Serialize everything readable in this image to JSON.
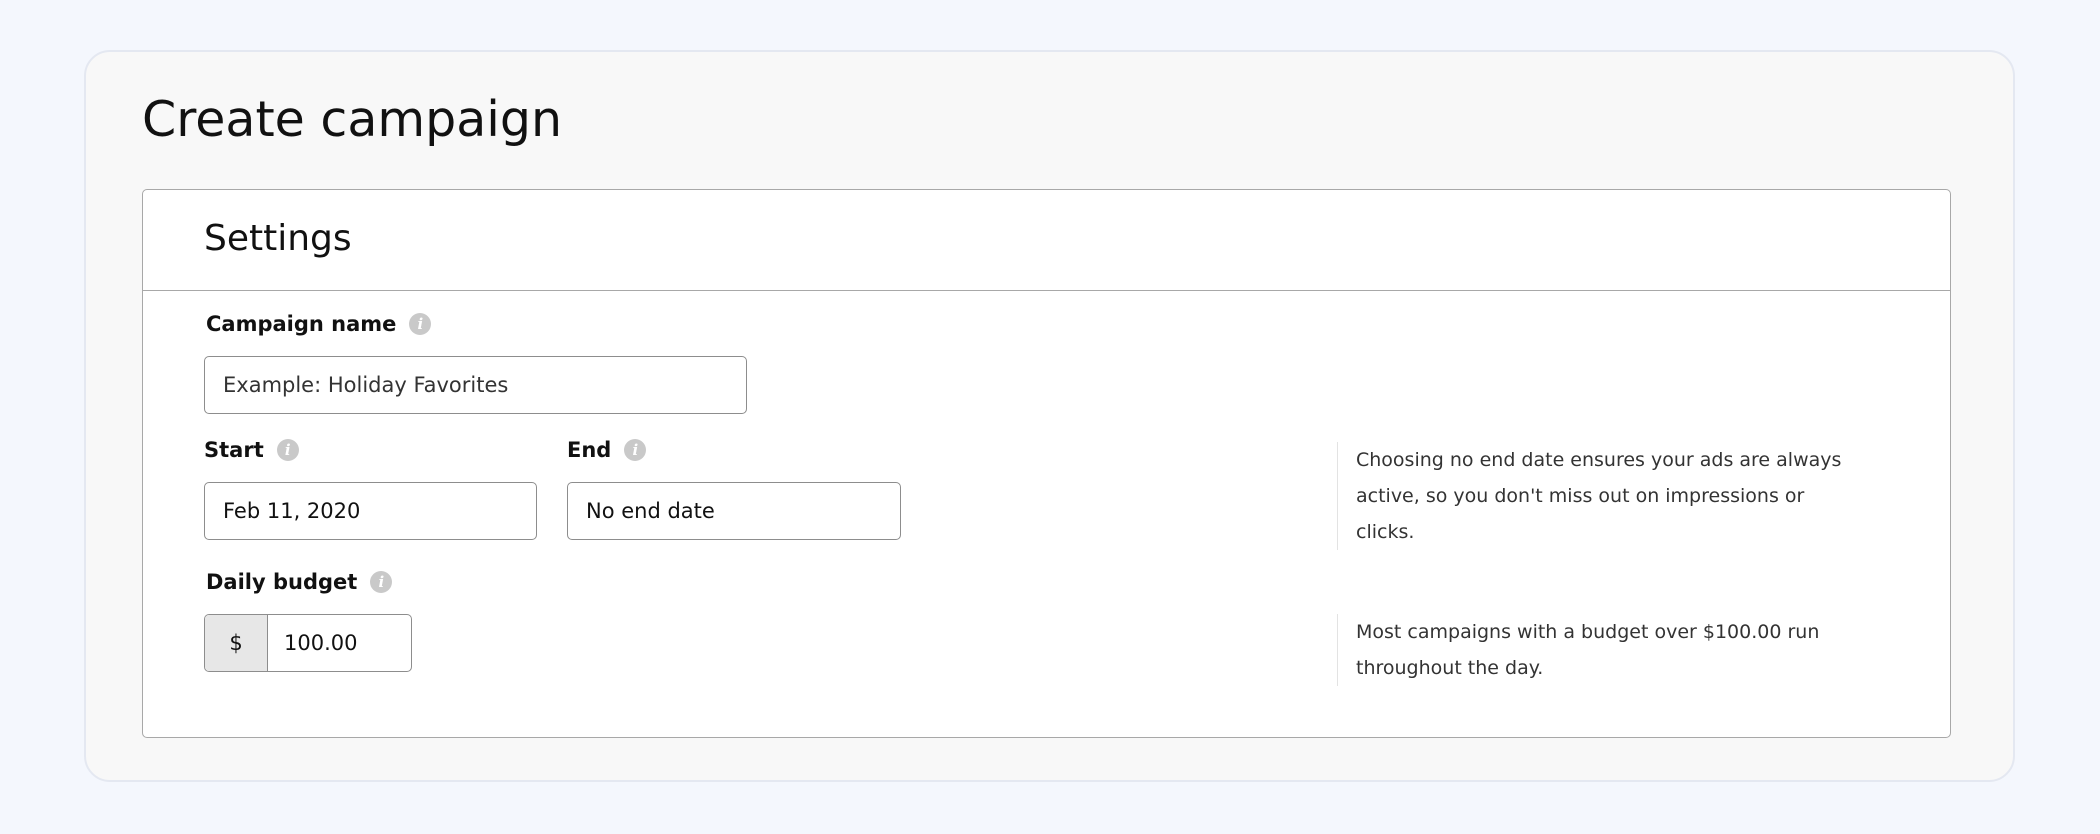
{
  "page": {
    "title": "Create campaign"
  },
  "settings": {
    "title": "Settings",
    "campaign_name": {
      "label": "Campaign name",
      "placeholder": "Example: Holiday Favorites"
    },
    "start": {
      "label": "Start",
      "value": "Feb 11, 2020"
    },
    "end": {
      "label": "End",
      "value": "No end date"
    },
    "daily_budget": {
      "label": "Daily budget",
      "currency_symbol": "$",
      "value": "100.00"
    },
    "help": {
      "end_date": "Choosing no end date ensures your ads are always active, so you don't miss out on impressions or clicks.",
      "budget": "Most campaigns with a budget over $100.00 run throughout the day."
    }
  },
  "icons": {
    "info": "info-icon"
  },
  "colors": {
    "page_background": "#f4f7fd",
    "card_background": "#f8f8f8",
    "panel_background": "#ffffff",
    "panel_border": "#a8a8a8",
    "input_border": "#8d8d8d",
    "info_icon": "#c9c9c9",
    "prefix_background": "#e7e7e7"
  }
}
